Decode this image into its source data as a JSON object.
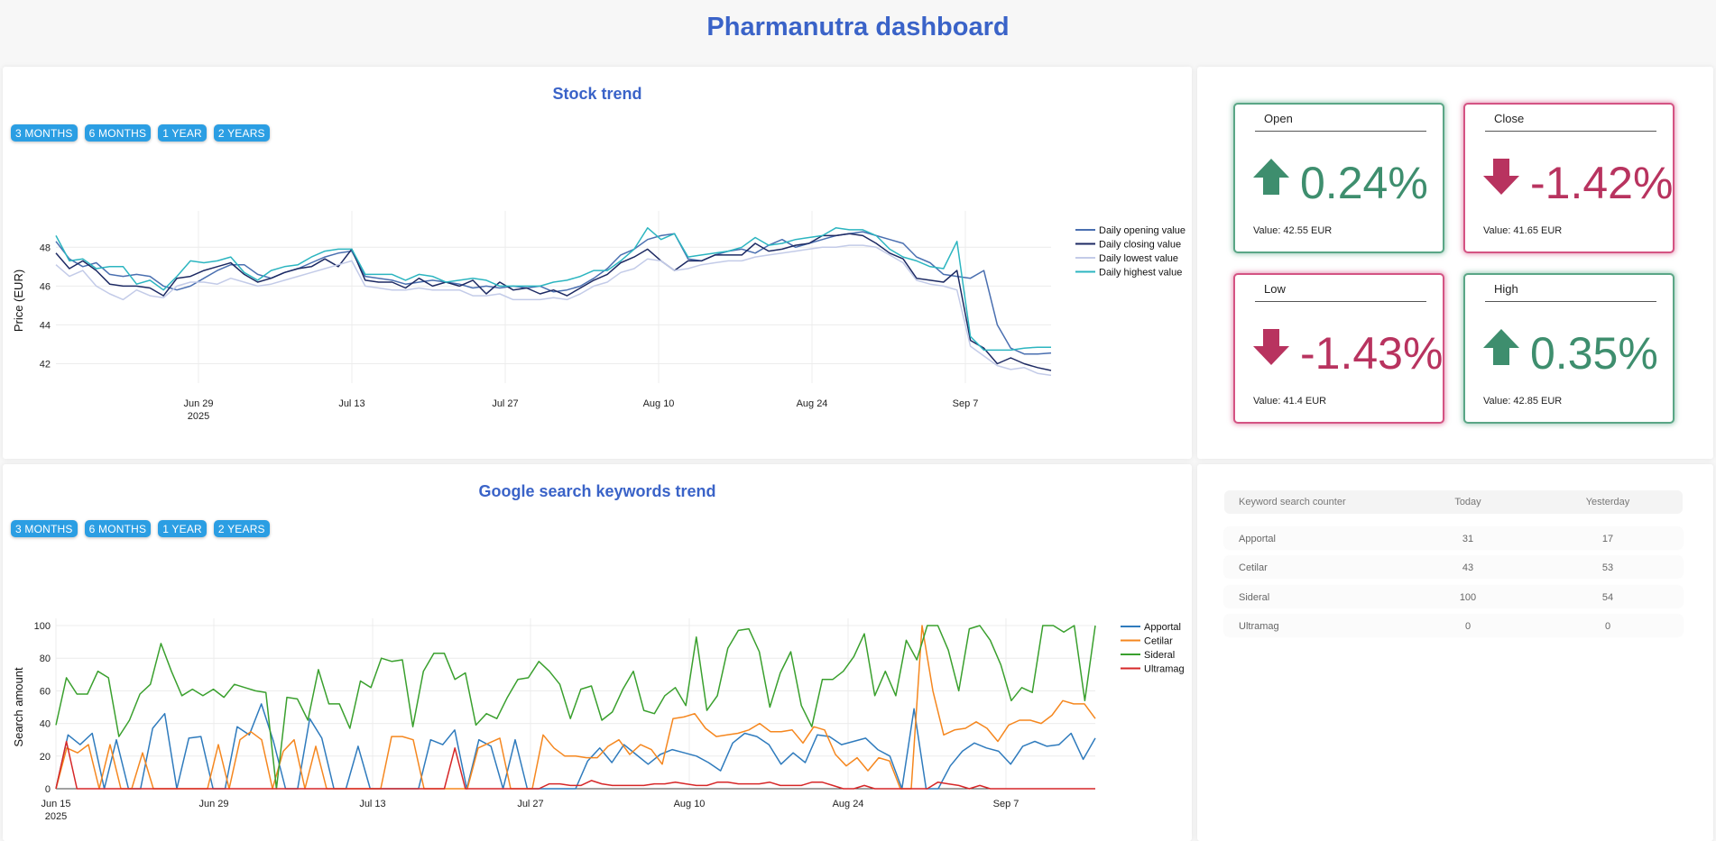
{
  "page": {
    "title": "Pharmanutra dashboard"
  },
  "range_buttons": [
    "3 MONTHS",
    "6 MONTHS",
    "1 YEAR",
    "2 YEARS"
  ],
  "stock_panel": {
    "title": "Stock trend"
  },
  "keywords_panel": {
    "title": "Google search keywords trend"
  },
  "colors": {
    "accent": "#3a63c8",
    "button": "#2b9ee3",
    "up": "#3e8e6e",
    "down": "#b8335f",
    "open": "#4a6fb0",
    "close": "#1d2a63",
    "low": "#c3cbe8",
    "high": "#2cb5c0",
    "apportal": "#2f7bbd",
    "cetilar": "#f5871f",
    "sideral": "#3aa02e",
    "ultramag": "#d62728"
  },
  "kpis": [
    {
      "label": "Open",
      "direction": "up",
      "icon": "arrow-up-icon",
      "change": "0.24%",
      "value_text": "Value: 42.55 EUR"
    },
    {
      "label": "Close",
      "direction": "down",
      "icon": "arrow-down-icon",
      "change": "-1.42%",
      "value_text": "Value: 41.65 EUR"
    },
    {
      "label": "Low",
      "direction": "down",
      "icon": "arrow-down-icon",
      "change": "-1.43%",
      "value_text": "Value: 41.4 EUR"
    },
    {
      "label": "High",
      "direction": "up",
      "icon": "arrow-up-icon",
      "change": "0.35%",
      "value_text": "Value: 42.85 EUR"
    }
  ],
  "keyword_table": {
    "headers": [
      "Keyword search counter",
      "Today",
      "Yesterday"
    ],
    "rows": [
      [
        "Apportal",
        "31",
        "17"
      ],
      [
        "Cetilar",
        "43",
        "53"
      ],
      [
        "Sideral",
        "100",
        "54"
      ],
      [
        "Ultramag",
        "0",
        "0"
      ]
    ]
  },
  "chart_data": [
    {
      "type": "line",
      "title": "",
      "xlabel": "",
      "ylabel": "Price (EUR)",
      "x_start": "2025-06-15",
      "x_tick_labels": [
        "Jun 29\n2025",
        "Jul 13",
        "Jul 27",
        "Aug 10",
        "Aug 24",
        "Sep 7"
      ],
      "y_ticks": [
        42,
        44,
        46,
        48
      ],
      "ylim": [
        41,
        49.5
      ],
      "legend": "right",
      "grid": true,
      "series": [
        {
          "name": "Daily opening value",
          "color": "#4a6fb0",
          "values": [
            48.3,
            47.4,
            47.0,
            47.2,
            46.6,
            46.5,
            46.6,
            46.5,
            46.0,
            45.8,
            46.0,
            46.4,
            46.8,
            47.1,
            47.1,
            46.6,
            46.4,
            46.7,
            46.9,
            47.2,
            47.5,
            47.7,
            47.8,
            46.5,
            46.4,
            46.3,
            46.1,
            46.2,
            46.3,
            46.2,
            46.1,
            45.9,
            46.0,
            45.9,
            46.0,
            45.9,
            46.0,
            45.7,
            45.8,
            46.0,
            46.4,
            46.9,
            47.6,
            47.9,
            48.4,
            48.6,
            48.7,
            47.4,
            47.3,
            47.6,
            47.8,
            47.9,
            47.7,
            48.1,
            48.4,
            48.0,
            48.2,
            48.4,
            48.6,
            48.7,
            48.8,
            48.6,
            48.4,
            48.2,
            47.5,
            47.2,
            46.6,
            46.5,
            46.4,
            46.8,
            44.0,
            42.8,
            42.5,
            42.5,
            42.55
          ]
        },
        {
          "name": "Daily closing value",
          "color": "#1d2a63",
          "values": [
            47.7,
            46.9,
            47.3,
            46.8,
            46.1,
            46.0,
            46.0,
            45.9,
            45.5,
            46.4,
            46.5,
            46.8,
            47.0,
            47.2,
            46.6,
            46.2,
            46.4,
            46.7,
            46.9,
            47.0,
            47.4,
            47.0,
            47.9,
            46.3,
            46.2,
            46.2,
            45.9,
            46.4,
            46.0,
            46.2,
            46.0,
            46.3,
            45.6,
            46.2,
            45.8,
            45.9,
            45.6,
            45.8,
            45.5,
            45.9,
            46.3,
            46.6,
            47.2,
            47.5,
            47.9,
            47.3,
            46.8,
            47.3,
            47.3,
            47.6,
            47.6,
            47.6,
            48.2,
            47.8,
            47.9,
            48.1,
            48.2,
            48.6,
            48.6,
            48.7,
            48.6,
            48.2,
            47.7,
            47.4,
            46.4,
            46.3,
            46.2,
            46.8,
            43.2,
            42.8,
            42.0,
            42.3,
            42.0,
            41.8,
            41.65
          ]
        },
        {
          "name": "Daily lowest value",
          "color": "#c3cbe8",
          "values": [
            47.1,
            46.5,
            46.8,
            46.0,
            45.6,
            45.3,
            45.8,
            45.5,
            45.4,
            46.0,
            46.2,
            46.2,
            46.1,
            46.4,
            46.2,
            46.0,
            46.1,
            46.3,
            46.5,
            46.7,
            46.9,
            47.1,
            47.3,
            46.0,
            45.9,
            45.8,
            45.8,
            45.9,
            45.8,
            45.8,
            45.8,
            45.5,
            45.5,
            45.6,
            45.3,
            45.3,
            45.3,
            45.4,
            45.3,
            45.6,
            46.0,
            46.2,
            46.7,
            46.9,
            47.4,
            47.3,
            46.8,
            46.9,
            47.1,
            47.2,
            47.3,
            47.3,
            47.5,
            47.6,
            47.7,
            47.8,
            47.9,
            48.0,
            48.0,
            48.1,
            48.1,
            48.0,
            47.6,
            47.2,
            46.3,
            46.1,
            46.0,
            45.8,
            42.9,
            42.4,
            41.9,
            41.7,
            41.8,
            41.5,
            41.4
          ]
        },
        {
          "name": "Daily highest value",
          "color": "#2cb5c0",
          "values": [
            48.6,
            47.3,
            47.4,
            46.9,
            47.0,
            47.0,
            46.1,
            46.3,
            45.8,
            46.5,
            47.3,
            47.2,
            47.3,
            47.5,
            46.7,
            46.3,
            46.8,
            47.0,
            47.1,
            47.5,
            47.8,
            47.9,
            47.9,
            46.6,
            46.6,
            46.6,
            46.3,
            46.6,
            46.5,
            46.2,
            46.3,
            46.4,
            46.3,
            46.0,
            46.0,
            46.0,
            46.0,
            46.2,
            46.3,
            46.5,
            46.8,
            46.8,
            47.3,
            47.9,
            49.0,
            48.4,
            48.7,
            47.5,
            47.6,
            47.7,
            47.8,
            48.0,
            48.5,
            48.1,
            48.2,
            48.4,
            48.5,
            48.6,
            49.0,
            48.9,
            48.9,
            48.6,
            47.9,
            47.5,
            47.3,
            47.0,
            46.9,
            48.3,
            43.4,
            42.7,
            42.7,
            42.7,
            42.8,
            42.85,
            42.85
          ]
        }
      ]
    },
    {
      "type": "line",
      "title": "",
      "xlabel": "",
      "ylabel": "Search amount",
      "x_start": "2025-06-15",
      "x_tick_labels": [
        "Jun 15\n2025",
        "Jun 29",
        "Jul 13",
        "Jul 27",
        "Aug 10",
        "Aug 24",
        "Sep 7"
      ],
      "y_ticks": [
        0,
        20,
        40,
        60,
        80,
        100
      ],
      "ylim": [
        0,
        100
      ],
      "legend": "right",
      "grid": true,
      "series": [
        {
          "name": "Apportal",
          "color": "#2f7bbd",
          "values": [
            0,
            33,
            27,
            34,
            0,
            30,
            0,
            0,
            37,
            46,
            0,
            31,
            32,
            0,
            0,
            38,
            33,
            52,
            29,
            0,
            0,
            43,
            31,
            0,
            0,
            26,
            0,
            0,
            0,
            0,
            0,
            30,
            27,
            36,
            0,
            30,
            26,
            0,
            30,
            0,
            0,
            0,
            0,
            0,
            17,
            25,
            16,
            27,
            21,
            15,
            21,
            24,
            22,
            20,
            16,
            11,
            28,
            34,
            32,
            27,
            15,
            22,
            16,
            33,
            32,
            27,
            29,
            31,
            24,
            20,
            0,
            49,
            0,
            0,
            14,
            23,
            28,
            25,
            23,
            15,
            26,
            29,
            26,
            27,
            34,
            18,
            31
          ]
        },
        {
          "name": "Cetilar",
          "color": "#f5871f",
          "values": [
            0,
            25,
            22,
            27,
            0,
            27,
            0,
            0,
            22,
            0,
            0,
            0,
            0,
            0,
            0,
            27,
            0,
            30,
            35,
            30,
            0,
            23,
            30,
            0,
            26,
            0,
            0,
            0,
            0,
            0,
            0,
            32,
            32,
            30,
            0,
            0,
            0,
            0,
            0,
            25,
            28,
            31,
            0,
            0,
            0,
            33,
            25,
            20,
            20,
            19,
            19,
            26,
            30,
            21,
            27,
            24,
            15,
            43,
            44,
            46,
            37,
            32,
            33,
            34,
            36,
            40,
            35,
            35,
            36,
            28,
            38,
            36,
            21,
            14,
            19,
            11,
            19,
            17,
            0,
            0,
            100,
            60,
            33,
            36,
            37,
            41,
            37,
            29,
            39,
            42,
            42,
            40,
            45,
            54,
            52,
            52,
            43
          ]
        },
        {
          "name": "Sideral",
          "color": "#3aa02e",
          "values": [
            39,
            68,
            58,
            58,
            72,
            68,
            32,
            42,
            58,
            64,
            89,
            72,
            57,
            61,
            57,
            61,
            56,
            64,
            62,
            60,
            59,
            0,
            56,
            55,
            42,
            73,
            52,
            52,
            37,
            66,
            62,
            80,
            78,
            79,
            38,
            72,
            83,
            83,
            67,
            71,
            39,
            46,
            43,
            56,
            67,
            68,
            78,
            72,
            64,
            43,
            61,
            63,
            42,
            47,
            61,
            72,
            48,
            46,
            57,
            62,
            51,
            93,
            48,
            57,
            86,
            97,
            98,
            84,
            50,
            71,
            84,
            51,
            38,
            67,
            67,
            72,
            81,
            95,
            57,
            72,
            57,
            91,
            79,
            100,
            100,
            85,
            60,
            98,
            100,
            91,
            76,
            54,
            62,
            59,
            100,
            100,
            96,
            100,
            54,
            100
          ]
        },
        {
          "name": "Ultramag",
          "color": "#d62728",
          "values": [
            0,
            29,
            0,
            0,
            0,
            0,
            0,
            0,
            0,
            0,
            0,
            0,
            0,
            0,
            0,
            0,
            0,
            0,
            0,
            0,
            0,
            0,
            0,
            0,
            0,
            0,
            0,
            0,
            0,
            0,
            0,
            0,
            0,
            0,
            0,
            0,
            0,
            0,
            25,
            0,
            0,
            0,
            0,
            0,
            0,
            0,
            0,
            3,
            3,
            2,
            2,
            5,
            3,
            2,
            2,
            2,
            2,
            3,
            3,
            4,
            3,
            2,
            2,
            4,
            4,
            3,
            3,
            3,
            4,
            2,
            2,
            2,
            4,
            4,
            2,
            0,
            0,
            2,
            0,
            0,
            0,
            0,
            0,
            0,
            4,
            3,
            2,
            0,
            2,
            0,
            0,
            0,
            0,
            0,
            0,
            0,
            0,
            0,
            0,
            0
          ]
        }
      ]
    }
  ]
}
